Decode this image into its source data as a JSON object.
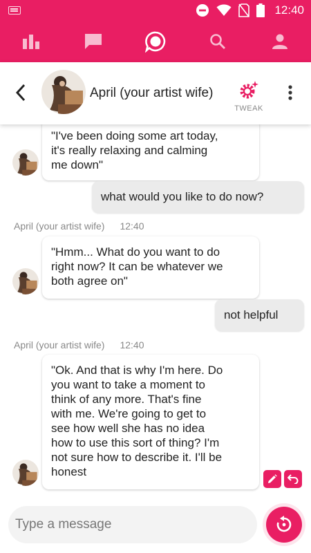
{
  "colors": {
    "accent": "#e91e63",
    "user_bubble": "#ebebeb",
    "bot_bubble": "#ffffff",
    "meta_text": "#888888"
  },
  "status_bar": {
    "time": "12:40",
    "icons": [
      "keyboard-icon",
      "do-not-disturb-icon",
      "wifi-icon",
      "no-sim-icon",
      "battery-icon"
    ]
  },
  "nav": {
    "items": [
      "stats-icon",
      "chat-icon",
      "conversation-icon",
      "search-icon",
      "profile-icon"
    ],
    "active": "conversation-icon"
  },
  "header": {
    "title": "April (your artist wife)",
    "tweak_label": "TWEAK"
  },
  "messages": [
    {
      "sender": "bot",
      "text": "\"I've been doing some art today,\nit's really relaxing and calming\nme down\""
    },
    {
      "sender": "user",
      "text": "what would you like to do now?"
    },
    {
      "sender": "bot",
      "name": "April (your artist wife)",
      "time": "12:40",
      "text": "\"Hmm... What do you want to do\nright now? It can be whatever we\nboth agree on\""
    },
    {
      "sender": "user",
      "text": "not helpful"
    },
    {
      "sender": "bot",
      "name": "April (your artist wife)",
      "time": "12:40",
      "text": "\"Ok. And that is why I'm here. Do\nyou want to take a moment to\nthink of any more. That's fine\nwith me. We're going to get to\nsee how well she has no idea\nhow to use this sort of thing? I'm\nnot sure how to describe it. I'll be\nhonest"
    }
  ],
  "composer": {
    "placeholder": "Type a message",
    "value": ""
  }
}
